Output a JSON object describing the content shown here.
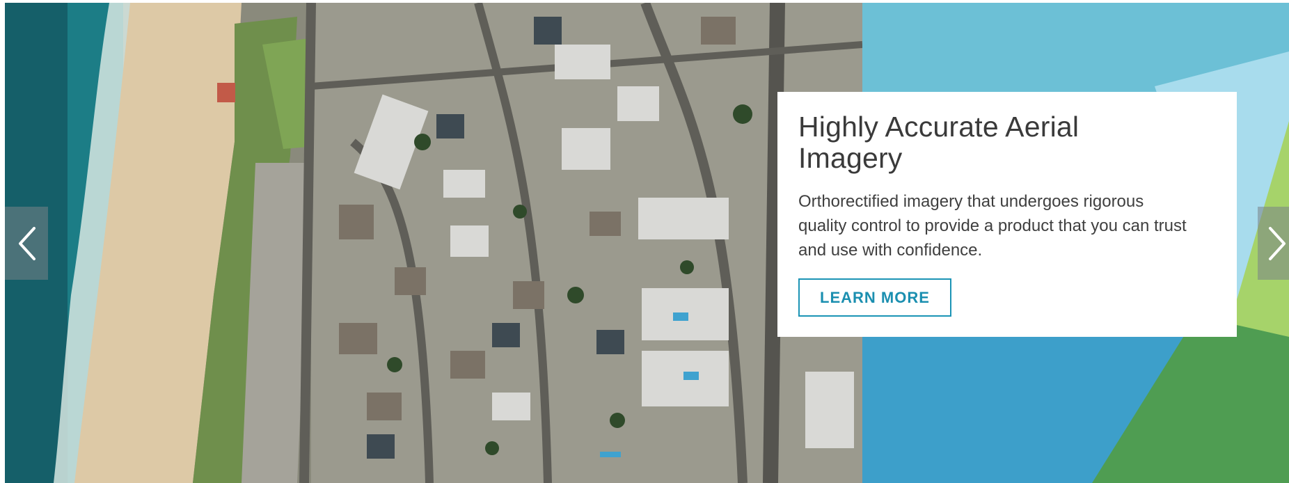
{
  "slide": {
    "title": "Highly Accurate Aerial Imagery",
    "body": "Orthorectified imagery that undergoes rigorous quality control to provide a product that you can trust and use with confidence.",
    "cta_label": "LEARN MORE"
  },
  "controls": {
    "prev_icon": "chevron-left-icon",
    "next_icon": "chevron-right-icon"
  },
  "colors": {
    "accent": "#1b94b5",
    "sky_blue": "#6cc0d6",
    "deep_blue": "#3d9fca",
    "light_green": "#a6d36a",
    "dark_green": "#4f9d52",
    "card_bg": "#ffffff"
  }
}
